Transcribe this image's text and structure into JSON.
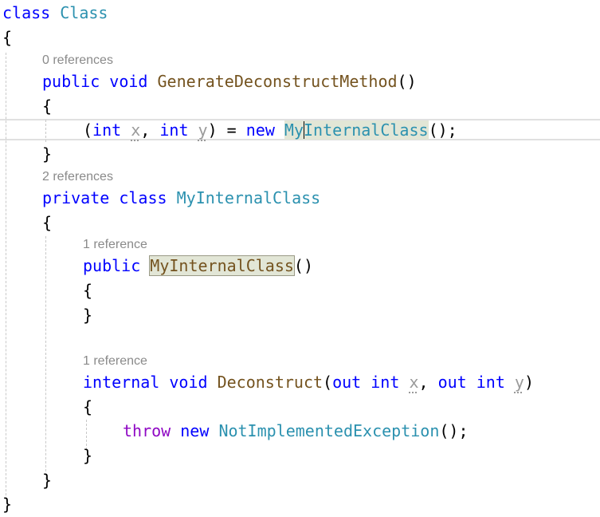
{
  "editor": {
    "lines": {
      "class_kw": "class",
      "class_name": "Class",
      "open_brace": "{",
      "close_brace": "}",
      "lens_method": "0 references",
      "method_public": "public",
      "method_void": "void",
      "method_name": "GenerateDeconstructMethod",
      "empty_parens": "()",
      "deconstruct_open": "(",
      "int_kw": "int",
      "var_x": "x",
      "comma": ",",
      "var_y": "y",
      "assign": ") =",
      "new_kw": "new",
      "ctor_call_my": "My",
      "ctor_call_rest": "InternalClass",
      "call_end": "();",
      "lens_class": "2 references",
      "private_kw": "private",
      "inner_class_name": "MyInternalClass",
      "lens_ctor": "1 reference",
      "ctor_name": "MyInternalClass",
      "lens_deconstruct": "1 reference",
      "internal_kw": "internal",
      "deconstruct_name": "Deconstruct",
      "out_kw": "out",
      "close_paren": ")",
      "throw_kw": "throw",
      "exception_type": "NotImplementedException"
    }
  }
}
